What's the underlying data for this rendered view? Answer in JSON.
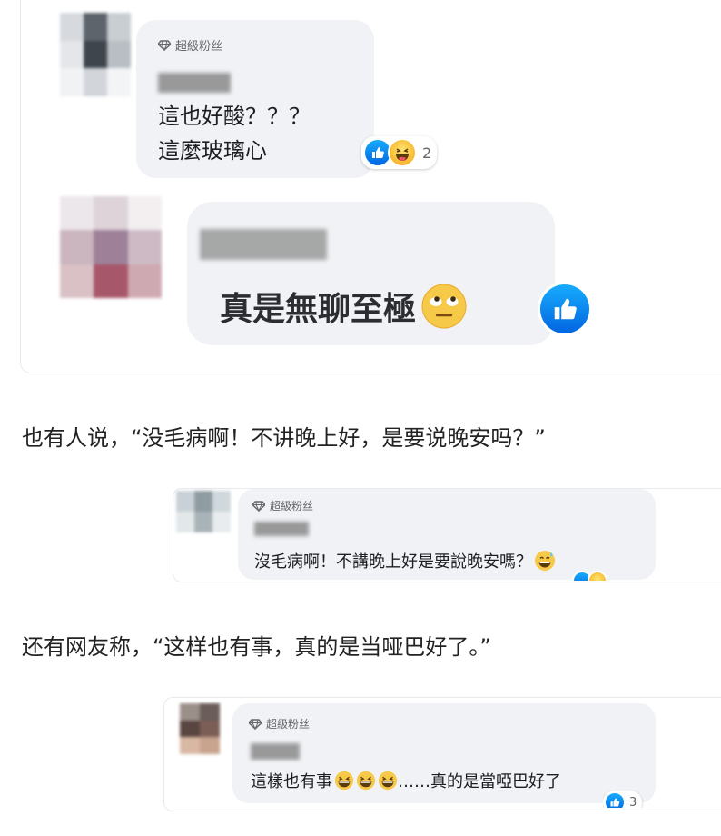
{
  "comment1": {
    "badge": "超級粉丝",
    "lines": [
      "這也好酸？？？",
      "這麼玻璃心"
    ],
    "reaction_count": "2",
    "reactions": [
      "like-icon",
      "haha-icon"
    ]
  },
  "comment2": {
    "text": "真是無聊至極",
    "emoji": "rolling-eyes-emoji",
    "reaction": "like-icon"
  },
  "caption1": "也有人说，“没毛病啊！不讲晚上好，是要说晚安吗？”",
  "comment3": {
    "badge": "超級粉丝",
    "text": "沒毛病啊！不講晚上好是要說晚安嗎？",
    "emoji": "grinning-sweat-emoji"
  },
  "caption2": "还有网友称，“这样也有事，真的是当哑巴好了。”",
  "comment4": {
    "badge": "超級粉丝",
    "text_before": "這樣也有事",
    "emojis": [
      "laughing-emoji",
      "laughing-emoji",
      "laughing-emoji"
    ],
    "text_after": "……真的是當啞巴好了",
    "reaction_count": "3"
  },
  "colors": {
    "bubble": "#f0f2f5",
    "like_blue": "#1877f2",
    "haha_yellow": "#f7b125",
    "meta_grey": "#65676b"
  }
}
